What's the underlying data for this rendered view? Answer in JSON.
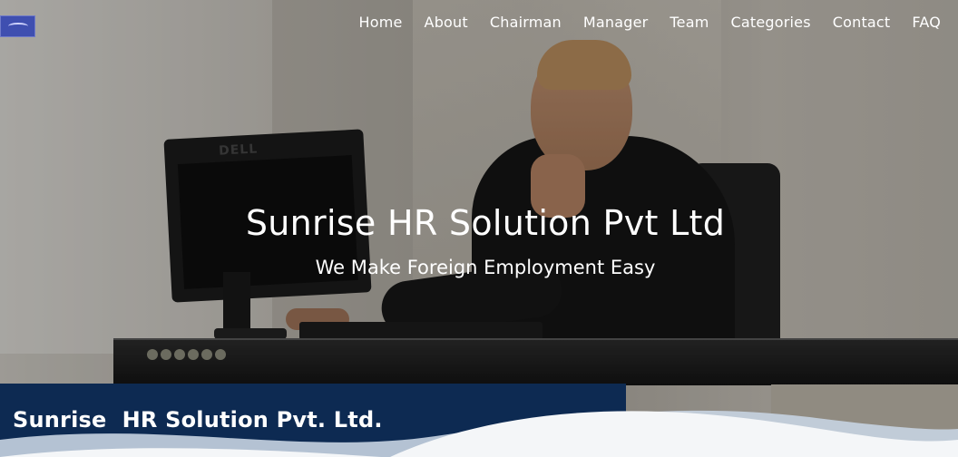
{
  "nav": {
    "items": [
      "Home",
      "About",
      "Chairman",
      "Manager",
      "Team",
      "Categories",
      "Contact",
      "FAQ"
    ]
  },
  "hero": {
    "title": "Sunrise HR Solution Pvt Ltd",
    "subtitle": "We Make Foreign Employment Easy",
    "monitor_logo": "DELL"
  },
  "banner": {
    "company_name": "Sunrise  HR Solution Pvt. Ltd."
  },
  "colors": {
    "banner_navy": "#0d2a52",
    "logo_blue": "#3f4fb0",
    "wave_light": "#f4f6f8",
    "wave_mid": "#c7d3e1"
  }
}
